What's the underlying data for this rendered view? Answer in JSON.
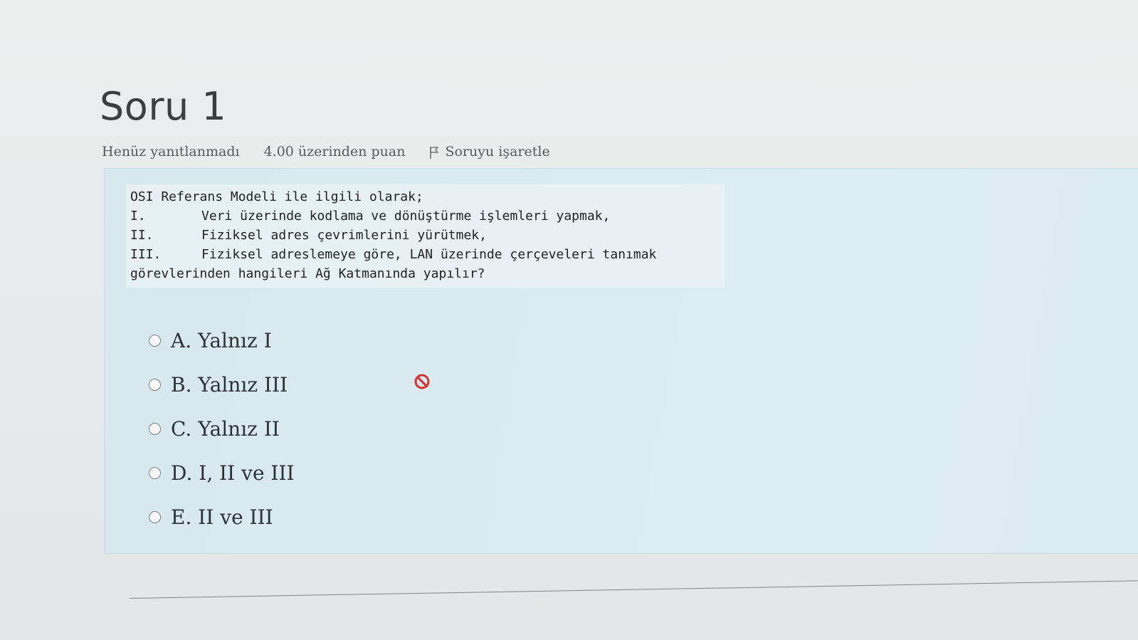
{
  "question": {
    "title": "Soru 1",
    "status": "Henüz yanıtlanmadı",
    "points": "4.00 üzerinden puan",
    "flag_label": "Soruyu işaretle",
    "text_lines": [
      {
        "num": "",
        "text": "OSI Referans Modeli ile ilgili olarak;"
      },
      {
        "num": "I.",
        "text": "Veri üzerinde kodlama ve dönüştürme işlemleri yapmak,"
      },
      {
        "num": "II.",
        "text": "Fiziksel adres çevrimlerini yürütmek,"
      },
      {
        "num": "III.",
        "text": "Fiziksel adreslemeye göre, LAN üzerinde çerçeveleri tanımak"
      },
      {
        "num": "",
        "text": "görevlerinden hangileri Ağ Katmanında yapılır?"
      }
    ],
    "options": [
      {
        "label": "A. Yalnız I"
      },
      {
        "label": "B. Yalnız III"
      },
      {
        "label": "C. Yalnız II"
      },
      {
        "label": "D. I, II ve III"
      },
      {
        "label": "E. II ve III"
      }
    ]
  },
  "icons": {
    "flag": "flag-icon",
    "cursor": "not-allowed-cursor-icon",
    "cursor_color": "#d9302c"
  }
}
